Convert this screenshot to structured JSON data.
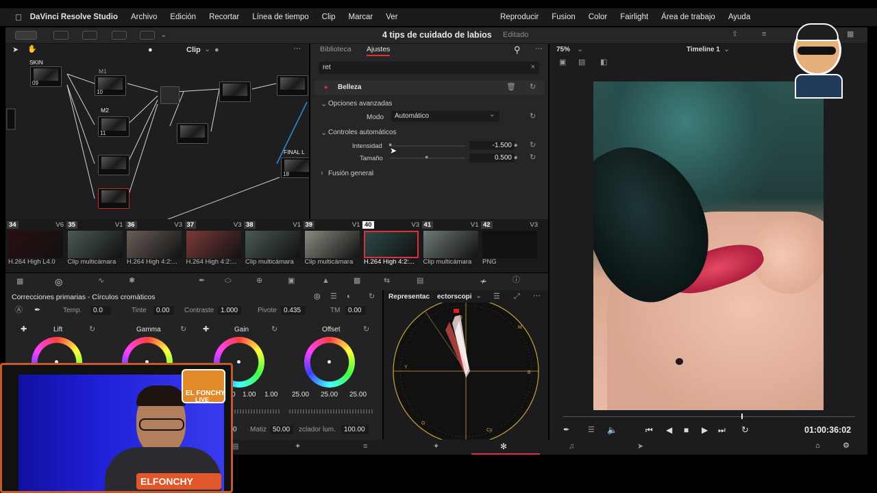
{
  "menubar": {
    "app": "DaVinci Resolve Studio",
    "items": [
      "Archivo",
      "Edición",
      "Recortar",
      "Línea de tiempo",
      "Clip",
      "Marcar",
      "Ver"
    ],
    "right_items": [
      "Reproducir",
      "Fusion",
      "Color",
      "Fairlight",
      "Área de trabajo",
      "Ayuda"
    ]
  },
  "titlebar": {
    "project": "4 tips de cuidado de labios",
    "status": "Editado"
  },
  "node_editor": {
    "mode": "Clip",
    "labels": {
      "skin": "SKIN",
      "m1": "M1",
      "m2": "M2",
      "final": "FINAL L"
    },
    "nodes": [
      "09",
      "10",
      "11",
      "18"
    ]
  },
  "settings": {
    "tabs": [
      "Biblioteca",
      "Ajustes"
    ],
    "search_value": "ret",
    "effect_name": "Belleza",
    "section_advanced": "Opciones avanzadas",
    "mode_label": "Modo",
    "mode_value": "Automático",
    "section_auto": "Controles automáticos",
    "intensity_label": "Intensidad",
    "intensity_value": "-1.500",
    "size_label": "Tamaño",
    "size_value": "0.500",
    "section_blend": "Fusión general"
  },
  "viewer": {
    "zoom": "75%",
    "timeline": "Timeline 1",
    "timecode": "01:00:36:02"
  },
  "clips": [
    {
      "num": "34",
      "track": "V6",
      "name": "H.264 High L4.0",
      "thumb": "#2a0e10"
    },
    {
      "num": "35",
      "track": "V1",
      "name": "Clip multicámara",
      "thumb": "#4a5a52"
    },
    {
      "num": "36",
      "track": "V3",
      "name": "H.264 High 4:2:...",
      "thumb": "#6a5e58"
    },
    {
      "num": "37",
      "track": "V3",
      "name": "H.264 High 4:2:...",
      "thumb": "#7a3a38"
    },
    {
      "num": "38",
      "track": "V1",
      "name": "Clip multicámara",
      "thumb": "#4a5a52"
    },
    {
      "num": "39",
      "track": "V1",
      "name": "Clip multicámara",
      "thumb": "#8a8a80"
    },
    {
      "num": "40",
      "track": "V3",
      "name": "H.264 High 4:2:...",
      "thumb": "#2c4a48"
    },
    {
      "num": "41",
      "track": "V1",
      "name": "Clip multicámara",
      "thumb": "#6e7a78"
    },
    {
      "num": "42",
      "track": "V3",
      "name": "PNG",
      "thumb": "#111111"
    }
  ],
  "primaries": {
    "title": "Correcciones primarias - Círculos cromáticos",
    "temp_label": "Temp.",
    "temp_value": "0.0",
    "tint_label": "Tinte",
    "tint_value": "0.00",
    "contrast_label": "Contraste",
    "contrast_value": "1.000",
    "pivot_label": "Pivote",
    "pivot_value": "0.435",
    "tm_label": "TM",
    "tm_value": "0.00",
    "wheels": [
      "Lift",
      "Gamma",
      "Gain",
      "Offset"
    ],
    "gain_values": [
      "0",
      "1.00",
      "1.00"
    ],
    "offset_values": [
      "25.00",
      "25.00",
      "25.00"
    ],
    "matiz_label": "Matiz",
    "matiz_value": "50.00",
    "lum_label": "zclador lum.",
    "lum_value": "100.00",
    "misc_value": "0"
  },
  "scope": {
    "label": "Representac",
    "mode": "ectorscopi"
  },
  "stream": {
    "name": "EL FONCHY",
    "sub": "LIVE",
    "tagline": "ELFONCHY"
  },
  "colors": {
    "accent_red": "#e0303a",
    "selected_clip": "#e0303a"
  }
}
